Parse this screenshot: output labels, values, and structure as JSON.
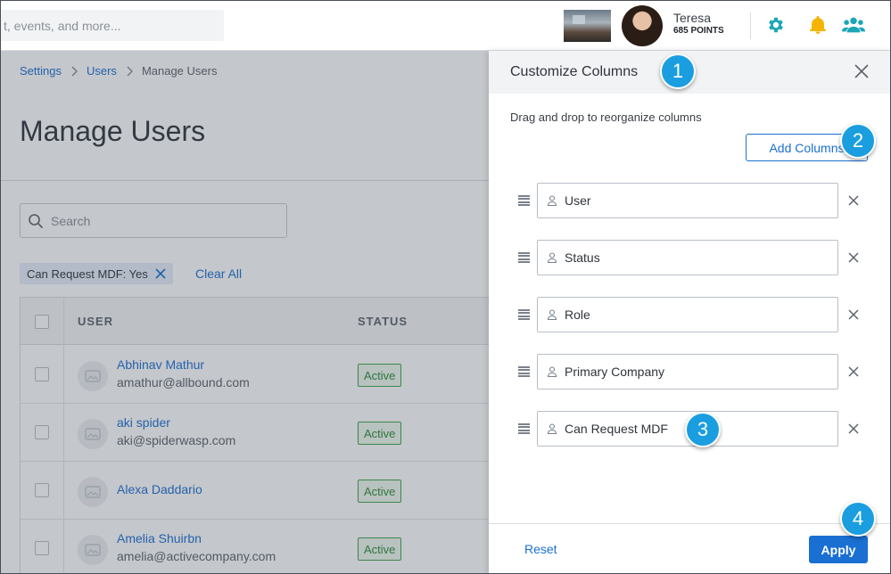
{
  "topbar": {
    "search_placeholder": "t, events, and more...",
    "user_name": "Teresa",
    "user_points": "685 POINTS"
  },
  "breadcrumb": {
    "items": [
      "Settings",
      "Users",
      "Manage Users"
    ],
    "separator": ">"
  },
  "page": {
    "title": "Manage Users",
    "search_placeholder": "Search",
    "filter_chip": "Can Request MDF: Yes",
    "clear_all": "Clear All"
  },
  "table": {
    "headers": {
      "user": "USER",
      "status": "STATUS"
    },
    "rows": [
      {
        "name": "Abhinav Mathur",
        "email": "amathur@allbound.com",
        "status": "Active"
      },
      {
        "name": "aki spider",
        "email": "aki@spiderwasp.com",
        "status": "Active"
      },
      {
        "name": "Alexa Daddario",
        "email": "",
        "status": "Active"
      },
      {
        "name": "Amelia Shuirbn",
        "email": "amelia@activecompany.com",
        "status": "Active"
      }
    ]
  },
  "panel": {
    "title": "Customize Columns",
    "subtitle": "Drag and drop to reorganize columns",
    "add_columns": "Add Columns",
    "columns": [
      "User",
      "Status",
      "Role",
      "Primary Company",
      "Can Request MDF"
    ],
    "reset": "Reset",
    "apply": "Apply"
  },
  "callouts": [
    "1",
    "2",
    "3",
    "4"
  ],
  "colors": {
    "accent": "#1a6fd3",
    "callout": "#1a9ee0",
    "teal_icon": "#1aa6b7",
    "bell": "#f5b400",
    "active_green": "#3fa34d"
  },
  "icons": [
    "gear-icon",
    "bell-icon",
    "users-icon",
    "search-icon",
    "close-icon",
    "user-icon",
    "drag-handle-icon",
    "chevron-right-icon"
  ]
}
